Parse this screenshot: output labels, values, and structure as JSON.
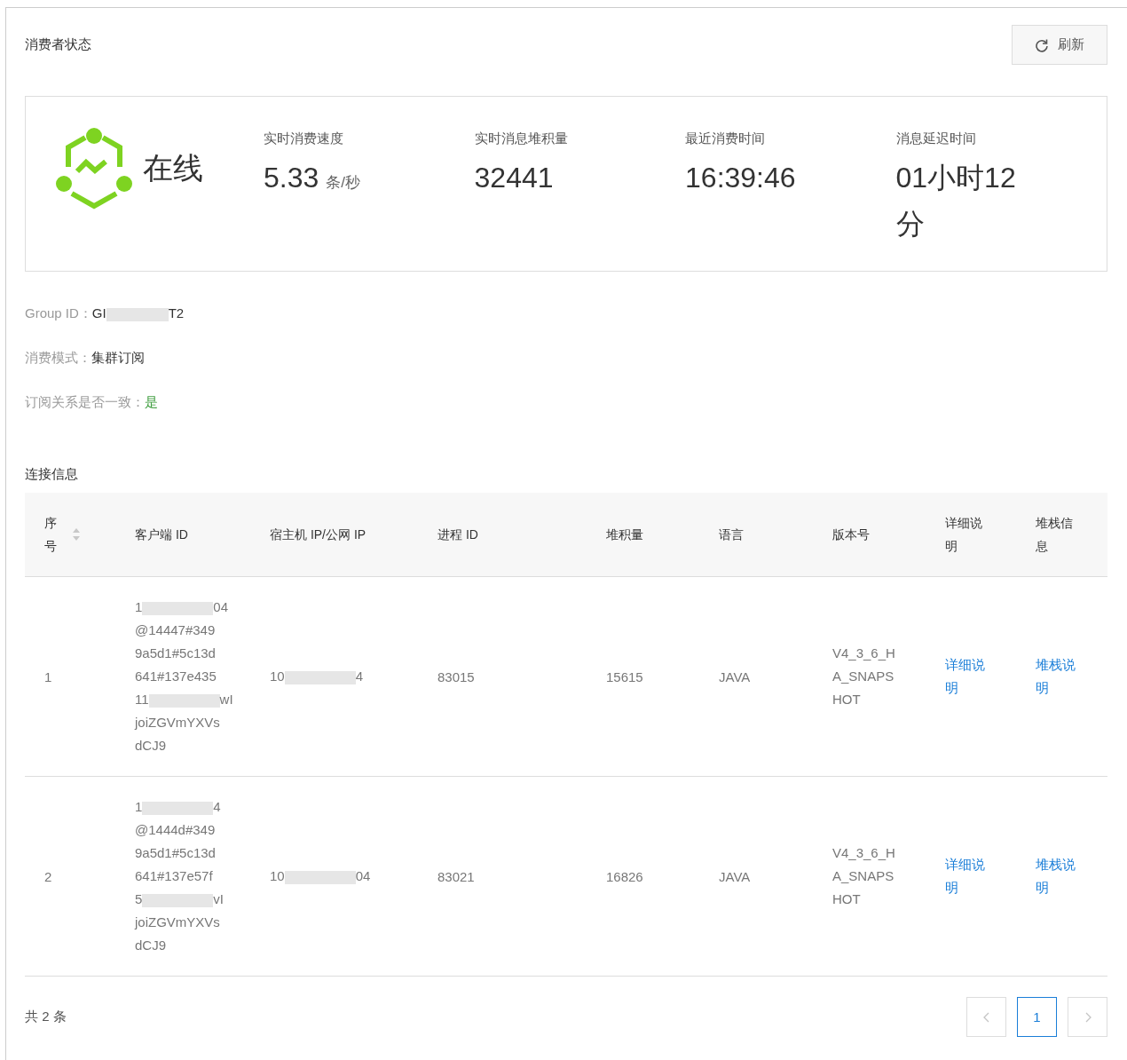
{
  "title": "消费者状态",
  "refresh_button": {
    "label": "刷新"
  },
  "status": {
    "label": "在线",
    "online": true,
    "stats": [
      {
        "label": "实时消费速度",
        "value": "5.33",
        "unit": "条/秒"
      },
      {
        "label": "实时消息堆积量",
        "value": "32441"
      },
      {
        "label": "最近消费时间",
        "value": "16:39:46"
      },
      {
        "label": "消息延迟时间",
        "value": "01小时12分"
      }
    ]
  },
  "info": [
    {
      "label": "Group ID：",
      "value": [
        {
          "kind": "text",
          "text": "GI"
        },
        {
          "kind": "redacted"
        },
        {
          "kind": "text",
          "text": "T2"
        }
      ],
      "kind": "plain"
    },
    {
      "label": "消费模式：",
      "value": [
        {
          "kind": "text",
          "text": "集群订阅"
        }
      ],
      "kind": "plain"
    },
    {
      "label": "订阅关系是否一致：",
      "value": [
        {
          "kind": "text",
          "text": "是"
        }
      ],
      "kind": "positive"
    }
  ],
  "section_title": "连接信息",
  "table": {
    "columns": [
      {
        "label": "序号",
        "sortable": true
      },
      {
        "label": "客户端 ID",
        "sortable": false
      },
      {
        "label": "宿主机 IP/公网 IP",
        "sortable": false
      },
      {
        "label": "进程 ID",
        "sortable": false
      },
      {
        "label": "堆积量",
        "sortable": false
      },
      {
        "label": "语言",
        "sortable": false
      },
      {
        "label": "版本号",
        "sortable": false
      },
      {
        "label": "详细说明",
        "sortable": false
      },
      {
        "label": "堆栈信息",
        "sortable": false
      }
    ],
    "rows": [
      {
        "index": "1",
        "client_id": [
          [
            {
              "kind": "text",
              "text": "1"
            },
            {
              "kind": "redacted"
            },
            {
              "kind": "text",
              "text": "04"
            }
          ],
          [
            {
              "kind": "text",
              "text": "@14447#349"
            }
          ],
          [
            {
              "kind": "text",
              "text": "9a5d1#5c13d"
            }
          ],
          [
            {
              "kind": "text",
              "text": "641#137e435"
            }
          ],
          [
            {
              "kind": "text",
              "text": "11"
            },
            {
              "kind": "redacted"
            },
            {
              "kind": "text",
              "text": "wI"
            }
          ],
          [
            {
              "kind": "text",
              "text": "joiZGVmYXVs"
            }
          ],
          [
            {
              "kind": "text",
              "text": "dCJ9"
            }
          ]
        ],
        "host_ip": [
          {
            "kind": "text",
            "text": "10"
          },
          {
            "kind": "redacted"
          },
          {
            "kind": "text",
            "text": "4"
          }
        ],
        "pid": "83015",
        "backlog": "15615",
        "language": "JAVA",
        "version": [
          "V4_3_6_H",
          "A_SNAPS",
          "HOT"
        ],
        "detail_link": "详细说明",
        "stack_link": "堆栈说明"
      },
      {
        "index": "2",
        "client_id": [
          [
            {
              "kind": "text",
              "text": "1"
            },
            {
              "kind": "redacted"
            },
            {
              "kind": "text",
              "text": "4"
            }
          ],
          [
            {
              "kind": "text",
              "text": "@1444d#349"
            }
          ],
          [
            {
              "kind": "text",
              "text": "9a5d1#5c13d"
            }
          ],
          [
            {
              "kind": "text",
              "text": "641#137e57f"
            }
          ],
          [
            {
              "kind": "text",
              "text": "5"
            },
            {
              "kind": "redacted"
            },
            {
              "kind": "text",
              "text": "vI"
            }
          ],
          [
            {
              "kind": "text",
              "text": "joiZGVmYXVs"
            }
          ],
          [
            {
              "kind": "text",
              "text": "dCJ9"
            }
          ]
        ],
        "host_ip": [
          {
            "kind": "text",
            "text": "10"
          },
          {
            "kind": "redacted"
          },
          {
            "kind": "text",
            "text": "04"
          }
        ],
        "pid": "83021",
        "backlog": "16826",
        "language": "JAVA",
        "version": [
          "V4_3_6_H",
          "A_SNAPS",
          "HOT"
        ],
        "detail_link": "详细说明",
        "stack_link": "堆栈说明"
      }
    ]
  },
  "footer": {
    "total": "共 2 条",
    "pages": [
      {
        "label": "1",
        "selected": true
      }
    ],
    "prev_disabled": true,
    "next_disabled": true
  }
}
